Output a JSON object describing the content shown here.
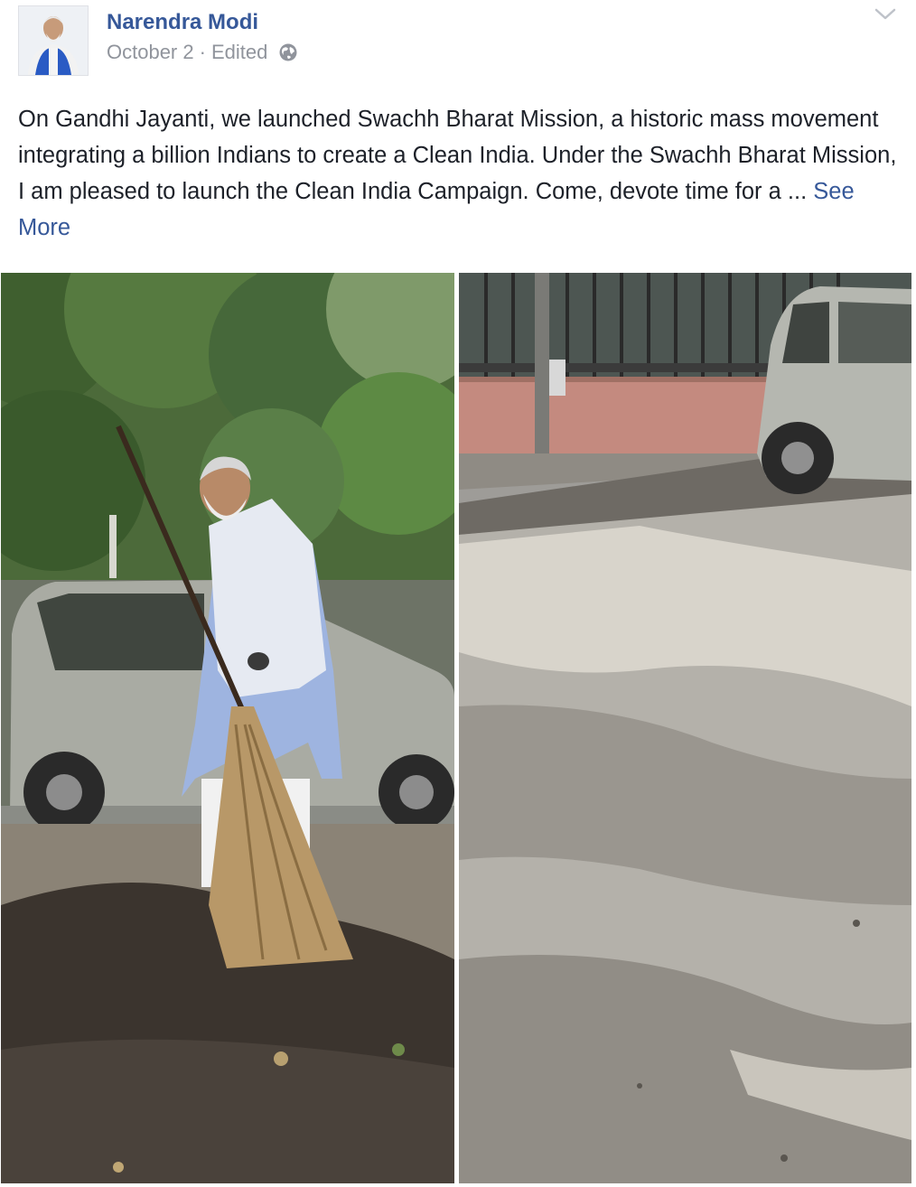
{
  "post": {
    "author": "Narendra Modi",
    "date": "October 2",
    "separator": "·",
    "edited": "Edited",
    "privacy_icon": "globe-icon",
    "options_icon": "chevron-down-icon",
    "text": "On Gandhi Jayanti, we launched Swachh Bharat Mission, a historic mass movement integrating a billion Indians to create a Clean India. Under the Swachh Bharat Mission, I am pleased to launch the Clean India Campaign. Come, devote time for a ... ",
    "see_more": "See More"
  },
  "colors": {
    "link": "#365899",
    "meta": "#90949c",
    "text": "#1d2129"
  }
}
